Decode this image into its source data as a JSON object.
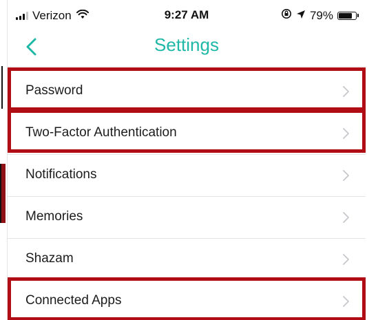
{
  "status_bar": {
    "carrier": "Verizon",
    "time": "9:27 AM",
    "battery": "79%",
    "battery_level": 0.79,
    "icons": [
      "signal-icon",
      "wifi-icon",
      "lock-rotation-icon",
      "location-arrow-icon",
      "battery-icon"
    ]
  },
  "nav": {
    "title": "Settings",
    "back_icon": "chevron-left-icon"
  },
  "settings": {
    "items": [
      {
        "label": "Password",
        "highlighted": true
      },
      {
        "label": "Two-Factor Authentication",
        "highlighted": true
      },
      {
        "label": "Notifications",
        "highlighted": false
      },
      {
        "label": "Memories",
        "highlighted": false
      },
      {
        "label": "Shazam",
        "highlighted": false
      },
      {
        "label": "Connected Apps",
        "highlighted": true
      }
    ],
    "chevron_icon": "chevron-right-icon"
  },
  "colors": {
    "accent": "#1fb8a6",
    "highlight": "#b00e14",
    "text": "#1c1c1c",
    "chevron": "#c7c7cc"
  }
}
